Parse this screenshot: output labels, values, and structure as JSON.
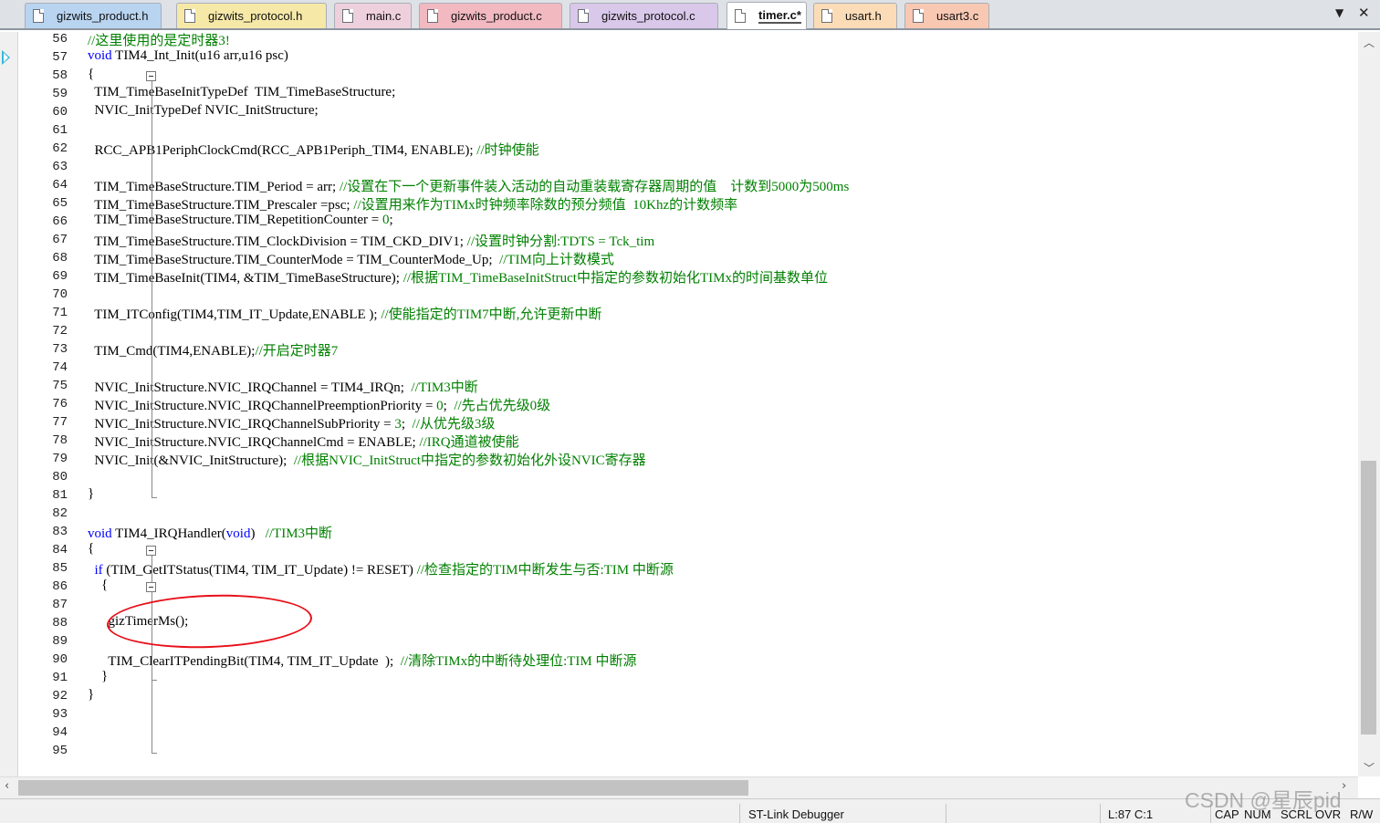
{
  "tabs": [
    {
      "label": "gizwits_product.h",
      "active": false,
      "color": "#b9d4f0"
    },
    {
      "label": "gizwits_protocol.h",
      "active": false,
      "color": "#f6e9a8"
    },
    {
      "label": "main.c",
      "active": false,
      "color": "#eed0dc"
    },
    {
      "label": "gizwits_product.c",
      "active": false,
      "color": "#f2b9c1"
    },
    {
      "label": "gizwits_protocol.c",
      "active": false,
      "color": "#d9c8ea"
    },
    {
      "label": "timer.c*",
      "active": true,
      "color": "#cfe9d2"
    },
    {
      "label": "usart.h",
      "active": false,
      "color": "#fbdcb7"
    },
    {
      "label": "usart3.c",
      "active": false,
      "color": "#f8c8b3"
    }
  ],
  "code_lines": [
    {
      "n": "56",
      "html": "<span class='cm'>//这里使用的是定时器3!</span>"
    },
    {
      "n": "57",
      "html": "<span class='kw'>void</span> TIM4_Int_Init(u16 arr,u16 psc)"
    },
    {
      "n": "58",
      "html": "{"
    },
    {
      "n": "59",
      "html": "  TIM_TimeBaseInitTypeDef  TIM_TimeBaseStructure;"
    },
    {
      "n": "60",
      "html": "  NVIC_InitTypeDef NVIC_InitStructure;"
    },
    {
      "n": "61",
      "html": ""
    },
    {
      "n": "62",
      "html": "  RCC_APB1PeriphClockCmd(RCC_APB1Periph_TIM4, ENABLE); <span class='cm'>//时钟使能</span>"
    },
    {
      "n": "63",
      "html": ""
    },
    {
      "n": "64",
      "html": "  TIM_TimeBaseStructure.TIM_Period = arr; <span class='cm'>//设置在下一个更新事件装入活动的自动重装载寄存器周期的值    计数到5000为500ms</span>"
    },
    {
      "n": "65",
      "html": "  TIM_TimeBaseStructure.TIM_Prescaler =psc; <span class='cm'>//设置用来作为TIMx时钟频率除数的预分频值  10Khz的计数频率</span>"
    },
    {
      "n": "66",
      "html": "  TIM_TimeBaseStructure.TIM_RepetitionCounter = <span class='cm'>0</span>;"
    },
    {
      "n": "67",
      "html": "  TIM_TimeBaseStructure.TIM_ClockDivision = TIM_CKD_DIV1; <span class='cm'>//设置时钟分割:TDTS = Tck_tim</span>"
    },
    {
      "n": "68",
      "html": "  TIM_TimeBaseStructure.TIM_CounterMode = TIM_CounterMode_Up;  <span class='cm'>//TIM向上计数模式</span>"
    },
    {
      "n": "69",
      "html": "  TIM_TimeBaseInit(TIM4, &amp;TIM_TimeBaseStructure); <span class='cm'>//根据TIM_TimeBaseInitStruct中指定的参数初始化TIMx的时间基数单位</span>"
    },
    {
      "n": "70",
      "html": ""
    },
    {
      "n": "71",
      "html": "  TIM_ITConfig(TIM4,TIM_IT_Update,ENABLE ); <span class='cm'>//使能指定的TIM7中断,允许更新中断</span>"
    },
    {
      "n": "72",
      "html": ""
    },
    {
      "n": "73",
      "html": "  TIM_Cmd(TIM4,ENABLE);<span class='cm'>//开启定时器7</span>"
    },
    {
      "n": "74",
      "html": ""
    },
    {
      "n": "75",
      "html": "  NVIC_InitStructure.NVIC_IRQChannel = TIM4_IRQn;  <span class='cm'>//TIM3中断</span>"
    },
    {
      "n": "76",
      "html": "  NVIC_InitStructure.NVIC_IRQChannelPreemptionPriority = <span class='cm'>0</span>;  <span class='cm'>//先占优先级0级</span>"
    },
    {
      "n": "77",
      "html": "  NVIC_InitStructure.NVIC_IRQChannelSubPriority = <span class='cm'>3</span>;  <span class='cm'>//从优先级3级</span>"
    },
    {
      "n": "78",
      "html": "  NVIC_InitStructure.NVIC_IRQChannelCmd = ENABLE; <span class='cm'>//IRQ通道被使能</span>"
    },
    {
      "n": "79",
      "html": "  NVIC_Init(&amp;NVIC_InitStructure);  <span class='cm'>//根据NVIC_InitStruct中指定的参数初始化外设NVIC寄存器</span>"
    },
    {
      "n": "80",
      "html": ""
    },
    {
      "n": "81",
      "html": "}"
    },
    {
      "n": "82",
      "html": ""
    },
    {
      "n": "83",
      "html": "<span class='kw'>void</span> TIM4_IRQHandler(<span class='kw'>void</span>)   <span class='cm'>//TIM3中断</span>"
    },
    {
      "n": "84",
      "html": "{"
    },
    {
      "n": "85",
      "html": "  <span class='kw'>if</span> (TIM_GetITStatus(TIM4, TIM_IT_Update) != RESET) <span class='cm'>//检查指定的TIM中断发生与否:TIM 中断源</span>"
    },
    {
      "n": "86",
      "html": "    {"
    },
    {
      "n": "87",
      "html": ""
    },
    {
      "n": "88",
      "html": "      gizTimerMs();"
    },
    {
      "n": "89",
      "html": ""
    },
    {
      "n": "90",
      "html": "      TIM_ClearITPendingBit(TIM4, TIM_IT_Update  );  <span class='cm'>//清除TIMx的中断待处理位:TIM 中断源</span>"
    },
    {
      "n": "91",
      "html": "    }"
    },
    {
      "n": "92",
      "html": "}"
    },
    {
      "n": "93",
      "html": ""
    },
    {
      "n": "94",
      "html": ""
    },
    {
      "n": "95",
      "html": ""
    }
  ],
  "status": {
    "debugger": "ST-Link Debugger",
    "position": "L:87 C:1",
    "cap": "CAP",
    "num": "NUM",
    "scrl": "SCRL",
    "ovr": "OVR",
    "rw": "R/W"
  },
  "watermark": "CSDN @星辰pid",
  "icons": {
    "tab_menu": "chevron-down-icon",
    "tab_close": "close-icon",
    "execution": "execution-arrow-icon"
  }
}
